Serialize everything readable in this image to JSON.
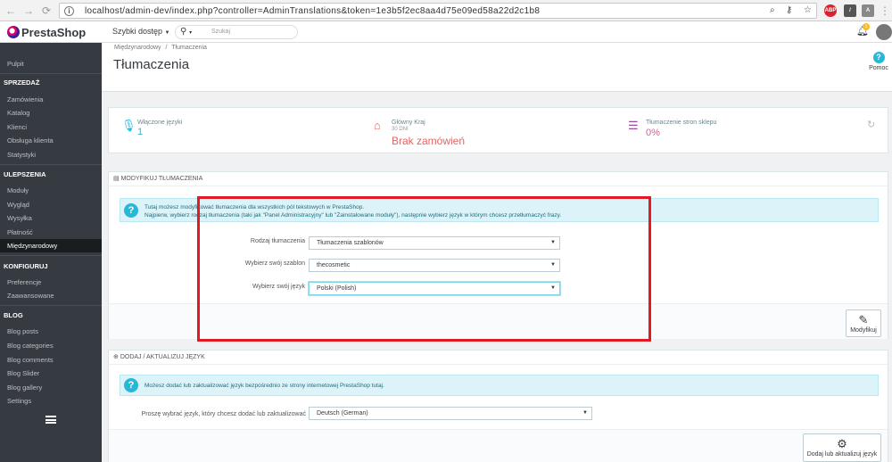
{
  "browser": {
    "url": "localhost/admin-dev/index.php?controller=AdminTranslations&token=1e3b5f2ec8aa4d75e09ed58a22d2c1b8"
  },
  "topbar": {
    "brand": "PrestaShop",
    "quick_access": "Szybki dostęp",
    "search_placeholder": "Szukaj",
    "notification_count": "1"
  },
  "sidebar": {
    "dashboard": "Pulpit",
    "sections": [
      {
        "title": "SPRZEDAŻ",
        "items": [
          "Zamówienia",
          "Katalog",
          "Klienci",
          "Obsługa klienta",
          "Statystyki"
        ]
      },
      {
        "title": "ULEPSZENIA",
        "items": [
          "Moduły",
          "Wygląd",
          "Wysyłka",
          "Płatność",
          "Międzynarodowy"
        ]
      },
      {
        "title": "KONFIGURUJ",
        "items": [
          "Preferencje",
          "Zaawansowane"
        ]
      },
      {
        "title": "BLOG",
        "items": [
          "Blog posts",
          "Blog categories",
          "Blog comments",
          "Blog Slider",
          "Blog gallery",
          "Settings"
        ]
      }
    ],
    "active_item": "Międzynarodowy"
  },
  "header": {
    "breadcrumb_parent": "Międzynarodowy",
    "breadcrumb_sep": "/",
    "breadcrumb_current": "Tłumaczenia",
    "title": "Tłumaczenia",
    "help_label": "Pomoc"
  },
  "kpis": [
    {
      "label": "Włączone języki",
      "value": "1",
      "icon": "microphone-icon",
      "color": "#25b9d7"
    },
    {
      "label": "Główny Kraj",
      "sub": "30 DNI",
      "value": "Brak zamówień",
      "icon": "home-icon",
      "color": "#e46464"
    },
    {
      "label": "Tłumaczenie stron sklepu",
      "value": "0%",
      "icon": "list-icon",
      "color": "#a04ba0"
    }
  ],
  "modify_panel": {
    "heading": "MODYFIKUJ TŁUMACZENIA",
    "info_line1": "Tutaj możesz modyfikować tłumaczenia dla wszystkich pól tekstowych w PrestaShop.",
    "info_line2": "Najpierw, wybierz rodzaj tłumaczenia (taki jak \"Panel Administracyjny\" lub \"Zainstalowane moduły\"), następnie wybierz język w którym chcesz przetłumaczyć frazy.",
    "fields": [
      {
        "label": "Rodzaj tłumaczenia",
        "value": "Tłumaczenia szablonów"
      },
      {
        "label": "Wybierz swój szablon",
        "value": "thecosmetic"
      },
      {
        "label": "Wybierz swój język",
        "value": "Polski (Polish)"
      }
    ],
    "button": "Modyfikuj"
  },
  "language_panel": {
    "heading": "DODAJ / AKTUALIZUJ JĘZYK",
    "info": "Możesz dodać lub zaktualizować język bezpośrednio ze strony internetowej PrestaShop tutaj.",
    "label": "Proszę wybrać język, który chcesz dodać lub zaktualizować",
    "value": "Deutsch (German)",
    "button": "Dodaj lub aktualizuj język"
  }
}
